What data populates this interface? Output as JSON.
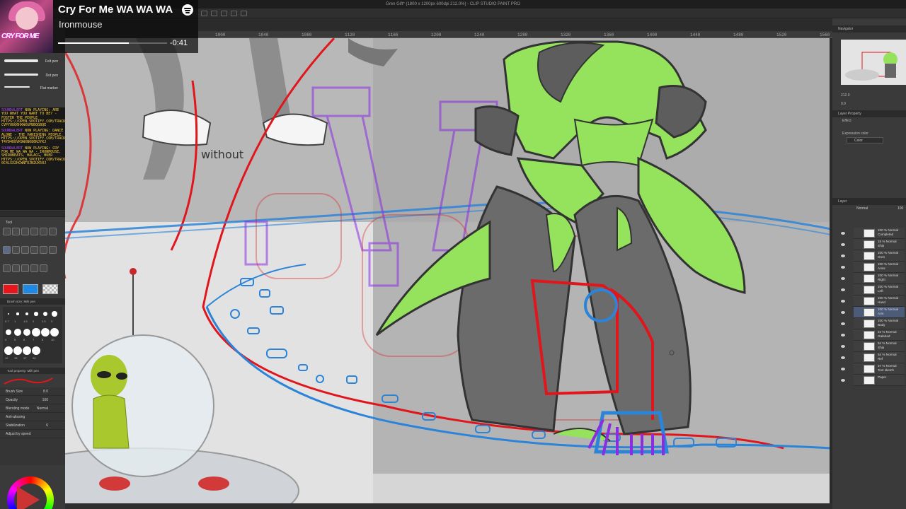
{
  "window": {
    "title": "Gren Gift* (1800 x 1200px 600dpi 212.0%) - CLIP STUDIO PAINT PRO"
  },
  "music": {
    "song": "Cry For Me WA WA WA",
    "artist": "Ironmouse",
    "time_remaining": "-0:41",
    "cover_text": "CRY FOR ME",
    "progress": 0.65,
    "icon": "spotify-icon"
  },
  "ruler": {
    "ticks": [
      "1000",
      "1040",
      "1080",
      "1120",
      "1160",
      "1200",
      "1240",
      "1280",
      "1320",
      "1360",
      "1400",
      "1440",
      "1480",
      "1520",
      "1560"
    ]
  },
  "brushes": [
    {
      "label": "Felt pen"
    },
    {
      "label": "Dot pen"
    },
    {
      "label": "Flat marker"
    }
  ],
  "chat": [
    {
      "user": "SOUNDALERT",
      "text": "NOW PLAYING: ARE YOU WHAT YOU WANT TO BE? - FOSTER THE PEOPLE HTTPS://OPEN.SPOTIFY.COM/TRACK/1 CVPYUUQ6HXWXGPBBQGBQE"
    },
    {
      "user": "SOUNDALERT",
      "text": "NOW PLAYING: DANCE ALONE - THE VANISHING PEOPLE. HTTPS://OPEN.SPOTIFY.COM/TRACK/1 T4YD4D8VK9WXNO86NJYKJ"
    },
    {
      "user": "SOUNDALERT",
      "text": "NOW PLAYING: CRY FOR ME WA WA WA - IRONMOUSE, SHIROBEATS, HALACG, BUER HTTPS://OPEN.SPOTIFY.COM/TRACK/2 0C4LSX2HCWNTUJN2UX50J"
    }
  ],
  "tool_panel": {
    "header": "Tool",
    "brush_size_header": "Brush size: Milli pen",
    "property_header": "Tool property: Milli pen"
  },
  "brush_sizes": [
    "0.7",
    "1",
    "1.5",
    "2",
    "2.5",
    "3",
    "4",
    "5",
    "6",
    "7",
    "8",
    "10",
    "12",
    "15",
    "17",
    "20"
  ],
  "properties": [
    {
      "label": "Brush Size",
      "value": "8.0"
    },
    {
      "label": "Opacity",
      "value": "100"
    },
    {
      "label": "Blending mode",
      "value": "Normal"
    },
    {
      "label": "Anti-aliasing",
      "value": ""
    },
    {
      "label": "Stabilization",
      "value": "6"
    },
    {
      "label": "Adjust by speed",
      "value": ""
    }
  ],
  "colors": {
    "main": "#e8161b",
    "sub": "#1e88e5",
    "sketch_red": "#e0161c",
    "sketch_blue": "#2c84d8",
    "sketch_purple": "#8b2be2",
    "green": "#95e25d",
    "dark": "#5d5d5d"
  },
  "canvas": {
    "handwriting": "without"
  },
  "navigator": {
    "header": "Navigator",
    "zoom": "212.0",
    "angle": "0.0"
  },
  "layer_property": {
    "header": "Layer Property",
    "effect": "Effect",
    "expression_color": "Expression color",
    "color_value": "Color"
  },
  "layer_panel": {
    "header": "Layer",
    "blend": "Normal",
    "opacity": "100"
  },
  "layers": [
    {
      "percent": "100 %",
      "mode": "Normal",
      "name": "Completed",
      "selected": false
    },
    {
      "percent": "15 %",
      "mode": "Normal",
      "name": "Ship",
      "selected": false
    },
    {
      "percent": "100 %",
      "mode": "Normal",
      "name": "Gren",
      "selected": false
    },
    {
      "percent": "100 %",
      "mode": "Normal",
      "name": "Arms",
      "selected": false
    },
    {
      "percent": "100 %",
      "mode": "Normal",
      "name": "Right",
      "selected": false
    },
    {
      "percent": "100 %",
      "mode": "Normal",
      "name": "Left",
      "selected": false
    },
    {
      "percent": "100 %",
      "mode": "Normal",
      "name": "Hand",
      "selected": false
    },
    {
      "percent": "100 %",
      "mode": "Normal",
      "name": "Arm",
      "selected": true
    },
    {
      "percent": "100 %",
      "mode": "Normal",
      "name": "Body",
      "selected": false
    },
    {
      "percent": "24 %",
      "mode": "Normal",
      "name": "Galahad",
      "selected": false
    },
    {
      "percent": "54 %",
      "mode": "Normal",
      "name": "Ship",
      "selected": false
    },
    {
      "percent": "54 %",
      "mode": "Normal",
      "name": "Ref",
      "selected": false
    },
    {
      "percent": "37 %",
      "mode": "Normal",
      "name": "Text sketch",
      "selected": false
    },
    {
      "percent": "",
      "mode": "",
      "name": "Paper",
      "selected": false
    }
  ]
}
